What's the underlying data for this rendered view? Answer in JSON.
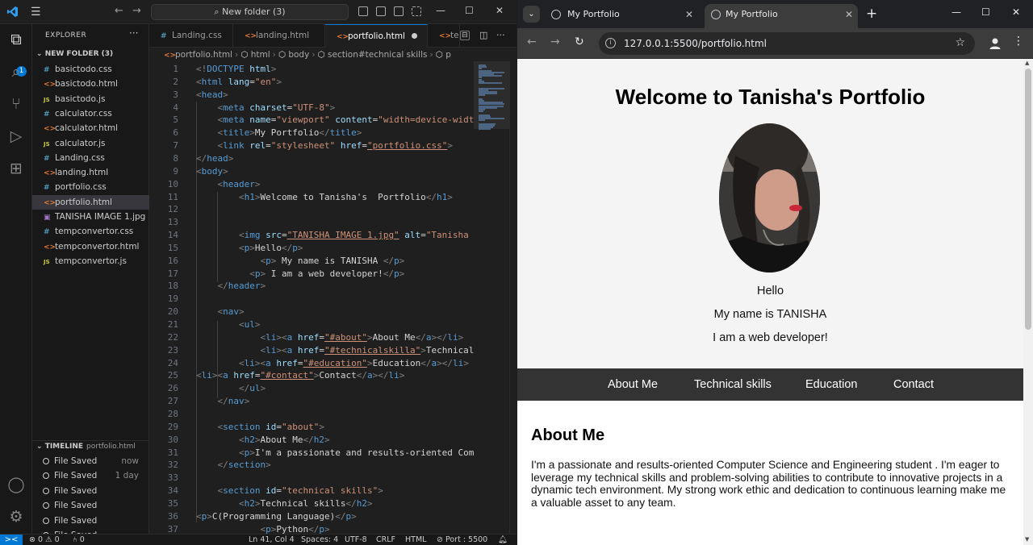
{
  "vscode": {
    "search": "New folder (3)",
    "explorer": {
      "header": "EXPLORER",
      "folder": "NEW FOLDER (3)",
      "files": [
        {
          "name": "basictodo.css",
          "type": "css"
        },
        {
          "name": "basictodo.html",
          "type": "html"
        },
        {
          "name": "basictodo.js",
          "type": "js"
        },
        {
          "name": "calculator.css",
          "type": "css"
        },
        {
          "name": "calculator.html",
          "type": "html"
        },
        {
          "name": "calculator.js",
          "type": "js"
        },
        {
          "name": "Landing.css",
          "type": "css"
        },
        {
          "name": "landing.html",
          "type": "html"
        },
        {
          "name": "portfolio.css",
          "type": "css"
        },
        {
          "name": "portfolio.html",
          "type": "html",
          "active": true
        },
        {
          "name": "TANISHA IMAGE 1.jpg",
          "type": "img"
        },
        {
          "name": "tempconvertor.css",
          "type": "css"
        },
        {
          "name": "tempconvertor.html",
          "type": "html"
        },
        {
          "name": "tempconvertor.js",
          "type": "js"
        }
      ]
    },
    "timeline": {
      "header": "TIMELINE",
      "file": "portfolio.html",
      "entries": [
        {
          "label": "File Saved",
          "time": "now"
        },
        {
          "label": "File Saved",
          "time": "1 day"
        },
        {
          "label": "File Saved",
          "time": ""
        },
        {
          "label": "File Saved",
          "time": ""
        },
        {
          "label": "File Saved",
          "time": ""
        },
        {
          "label": "File Saved",
          "time": ""
        }
      ]
    },
    "tabs": [
      {
        "label": "Landing.css",
        "type": "css"
      },
      {
        "label": "landing.html",
        "type": "html"
      },
      {
        "label": "portfolio.html",
        "type": "html",
        "active": true,
        "dirty": true
      },
      {
        "label": "tem",
        "type": "html"
      }
    ],
    "breadcrumb": [
      "portfolio.html",
      "html",
      "body",
      "section#technical skills",
      "p"
    ],
    "code_lines": [
      [
        [
          "d",
          "<!"
        ],
        [
          "t",
          "DOCTYPE"
        ],
        [
          "a",
          " html"
        ],
        [
          "d",
          ">"
        ]
      ],
      [
        [
          "d",
          "<"
        ],
        [
          "t",
          "html"
        ],
        [
          "a",
          " lang"
        ],
        [
          "x",
          "="
        ],
        [
          "s",
          "\"en\""
        ],
        [
          "d",
          ">"
        ]
      ],
      [
        [
          "d",
          "<"
        ],
        [
          "t",
          "head"
        ],
        [
          "d",
          ">"
        ]
      ],
      [
        [
          "x",
          "    "
        ],
        [
          "d",
          "<"
        ],
        [
          "t",
          "meta"
        ],
        [
          "a",
          " charset"
        ],
        [
          "x",
          "="
        ],
        [
          "s",
          "\"UTF-8\""
        ],
        [
          "d",
          ">"
        ]
      ],
      [
        [
          "x",
          "    "
        ],
        [
          "d",
          "<"
        ],
        [
          "t",
          "meta"
        ],
        [
          "a",
          " name"
        ],
        [
          "x",
          "="
        ],
        [
          "s",
          "\"viewport\""
        ],
        [
          "a",
          " content"
        ],
        [
          "x",
          "="
        ],
        [
          "s",
          "\"width=device-width,"
        ]
      ],
      [
        [
          "x",
          "    "
        ],
        [
          "d",
          "<"
        ],
        [
          "t",
          "title"
        ],
        [
          "d",
          ">"
        ],
        [
          "x",
          "My Portfolio"
        ],
        [
          "d",
          "</"
        ],
        [
          "t",
          "title"
        ],
        [
          "d",
          ">"
        ]
      ],
      [
        [
          "x",
          "    "
        ],
        [
          "d",
          "<"
        ],
        [
          "t",
          "link"
        ],
        [
          "a",
          " rel"
        ],
        [
          "x",
          "="
        ],
        [
          "s",
          "\"stylesheet\""
        ],
        [
          "a",
          " href"
        ],
        [
          "x",
          "="
        ],
        [
          "u",
          "\"portfolio.css\""
        ],
        [
          "d",
          ">"
        ]
      ],
      [
        [
          "d",
          "</"
        ],
        [
          "t",
          "head"
        ],
        [
          "d",
          ">"
        ]
      ],
      [
        [
          "d",
          "<"
        ],
        [
          "t",
          "body"
        ],
        [
          "d",
          ">"
        ]
      ],
      [
        [
          "x",
          "    "
        ],
        [
          "d",
          "<"
        ],
        [
          "t",
          "header"
        ],
        [
          "d",
          ">"
        ]
      ],
      [
        [
          "x",
          "        "
        ],
        [
          "d",
          "<"
        ],
        [
          "t",
          "h1"
        ],
        [
          "d",
          ">"
        ],
        [
          "x",
          "Welcome to Tanisha's  Portfolio"
        ],
        [
          "d",
          "</"
        ],
        [
          "t",
          "h1"
        ],
        [
          "d",
          ">"
        ]
      ],
      [],
      [],
      [
        [
          "x",
          "        "
        ],
        [
          "d",
          "<"
        ],
        [
          "t",
          "img"
        ],
        [
          "a",
          " src"
        ],
        [
          "x",
          "="
        ],
        [
          "u",
          "\"TANISHA IMAGE 1.jpg\""
        ],
        [
          "a",
          " alt"
        ],
        [
          "x",
          "="
        ],
        [
          "s",
          "\"Tanisha T"
        ]
      ],
      [
        [
          "x",
          "        "
        ],
        [
          "d",
          "<"
        ],
        [
          "t",
          "p"
        ],
        [
          "d",
          ">"
        ],
        [
          "x",
          "Hello"
        ],
        [
          "d",
          "</"
        ],
        [
          "t",
          "p"
        ],
        [
          "d",
          ">"
        ]
      ],
      [
        [
          "x",
          "            "
        ],
        [
          "d",
          "<"
        ],
        [
          "t",
          "p"
        ],
        [
          "d",
          ">"
        ],
        [
          "x",
          " My name is TANISHA "
        ],
        [
          "d",
          "</"
        ],
        [
          "t",
          "p"
        ],
        [
          "d",
          ">"
        ]
      ],
      [
        [
          "x",
          "          "
        ],
        [
          "d",
          "<"
        ],
        [
          "t",
          "p"
        ],
        [
          "d",
          ">"
        ],
        [
          "x",
          " I am a web developer!"
        ],
        [
          "d",
          "</"
        ],
        [
          "t",
          "p"
        ],
        [
          "d",
          ">"
        ]
      ],
      [
        [
          "x",
          "    "
        ],
        [
          "d",
          "</"
        ],
        [
          "t",
          "header"
        ],
        [
          "d",
          ">"
        ]
      ],
      [],
      [
        [
          "x",
          "    "
        ],
        [
          "d",
          "<"
        ],
        [
          "t",
          "nav"
        ],
        [
          "d",
          ">"
        ]
      ],
      [
        [
          "x",
          "        "
        ],
        [
          "d",
          "<"
        ],
        [
          "t",
          "ul"
        ],
        [
          "d",
          ">"
        ]
      ],
      [
        [
          "x",
          "            "
        ],
        [
          "d",
          "<"
        ],
        [
          "t",
          "li"
        ],
        [
          "d",
          "><"
        ],
        [
          "t",
          "a"
        ],
        [
          "a",
          " href"
        ],
        [
          "x",
          "="
        ],
        [
          "u",
          "\"#about\""
        ],
        [
          "d",
          ">"
        ],
        [
          "x",
          "About Me"
        ],
        [
          "d",
          "</"
        ],
        [
          "t",
          "a"
        ],
        [
          "d",
          "></"
        ],
        [
          "t",
          "li"
        ],
        [
          "d",
          ">"
        ]
      ],
      [
        [
          "x",
          "            "
        ],
        [
          "d",
          "<"
        ],
        [
          "t",
          "li"
        ],
        [
          "d",
          "><"
        ],
        [
          "t",
          "a"
        ],
        [
          "a",
          " href"
        ],
        [
          "x",
          "="
        ],
        [
          "u",
          "\"#technicalskilla\""
        ],
        [
          "d",
          ">"
        ],
        [
          "x",
          "Technical s"
        ]
      ],
      [
        [
          "x",
          "        "
        ],
        [
          "d",
          "<"
        ],
        [
          "t",
          "li"
        ],
        [
          "d",
          "><"
        ],
        [
          "t",
          "a"
        ],
        [
          "a",
          " href"
        ],
        [
          "x",
          "="
        ],
        [
          "u",
          "\"#education\""
        ],
        [
          "d",
          ">"
        ],
        [
          "x",
          "Education"
        ],
        [
          "d",
          "</"
        ],
        [
          "t",
          "a"
        ],
        [
          "d",
          "></"
        ],
        [
          "t",
          "li"
        ],
        [
          "d",
          ">"
        ]
      ],
      [
        [
          "d",
          "<"
        ],
        [
          "t",
          "li"
        ],
        [
          "d",
          "><"
        ],
        [
          "t",
          "a"
        ],
        [
          "a",
          " href"
        ],
        [
          "x",
          "="
        ],
        [
          "u",
          "\"#contact\""
        ],
        [
          "d",
          ">"
        ],
        [
          "x",
          "Contact"
        ],
        [
          "d",
          "</"
        ],
        [
          "t",
          "a"
        ],
        [
          "d",
          "></"
        ],
        [
          "t",
          "li"
        ],
        [
          "d",
          ">"
        ]
      ],
      [
        [
          "x",
          "        "
        ],
        [
          "d",
          "</"
        ],
        [
          "t",
          "ul"
        ],
        [
          "d",
          ">"
        ]
      ],
      [
        [
          "x",
          "    "
        ],
        [
          "d",
          "</"
        ],
        [
          "t",
          "nav"
        ],
        [
          "d",
          ">"
        ]
      ],
      [],
      [
        [
          "x",
          "    "
        ],
        [
          "d",
          "<"
        ],
        [
          "t",
          "section"
        ],
        [
          "a",
          " id"
        ],
        [
          "x",
          "="
        ],
        [
          "s",
          "\"about\""
        ],
        [
          "d",
          ">"
        ]
      ],
      [
        [
          "x",
          "        "
        ],
        [
          "d",
          "<"
        ],
        [
          "t",
          "h2"
        ],
        [
          "d",
          ">"
        ],
        [
          "x",
          "About Me"
        ],
        [
          "d",
          "</"
        ],
        [
          "t",
          "h2"
        ],
        [
          "d",
          ">"
        ]
      ],
      [
        [
          "x",
          "        "
        ],
        [
          "d",
          "<"
        ],
        [
          "t",
          "p"
        ],
        [
          "d",
          ">"
        ],
        [
          "x",
          "I'm a passionate and results-oriented Compu"
        ]
      ],
      [
        [
          "x",
          "    "
        ],
        [
          "d",
          "</"
        ],
        [
          "t",
          "section"
        ],
        [
          "d",
          ">"
        ]
      ],
      [],
      [
        [
          "x",
          "    "
        ],
        [
          "d",
          "<"
        ],
        [
          "t",
          "section"
        ],
        [
          "a",
          " id"
        ],
        [
          "x",
          "="
        ],
        [
          "s",
          "\"technical skills\""
        ],
        [
          "d",
          ">"
        ]
      ],
      [
        [
          "x",
          "        "
        ],
        [
          "d",
          "<"
        ],
        [
          "t",
          "h2"
        ],
        [
          "d",
          ">"
        ],
        [
          "x",
          "Technical skills"
        ],
        [
          "d",
          "</"
        ],
        [
          "t",
          "h2"
        ],
        [
          "d",
          ">"
        ]
      ],
      [
        [
          "d",
          "<"
        ],
        [
          "t",
          "p"
        ],
        [
          "d",
          ">"
        ],
        [
          "x",
          "C(Programming Language)"
        ],
        [
          "d",
          "</"
        ],
        [
          "t",
          "p"
        ],
        [
          "d",
          ">"
        ]
      ],
      [
        [
          "x",
          "            "
        ],
        [
          "d",
          "<"
        ],
        [
          "t",
          "p"
        ],
        [
          "d",
          ">"
        ],
        [
          "x",
          "Python"
        ],
        [
          "d",
          "</"
        ],
        [
          "t",
          "p"
        ],
        [
          "d",
          ">"
        ]
      ]
    ],
    "status": {
      "remote": "><",
      "problems": "⊗ 0 ⚠ 0",
      "ports": "⑃ 0",
      "cursor": "Ln 41, Col 4",
      "spaces": "Spaces: 4",
      "encoding": "UTF-8",
      "eol": "CRLF",
      "language": "HTML",
      "port": "⊘ Port : 5500"
    }
  },
  "chrome": {
    "tabs": [
      {
        "title": "My Portfolio",
        "active": false
      },
      {
        "title": "My Portfolio",
        "active": true
      }
    ],
    "url": "127.0.0.1:5500/portfolio.html",
    "page": {
      "title": "Welcome to Tanisha's Portfolio",
      "hello": "Hello",
      "name_line": "My name is TANISHA",
      "role_line": "I am a web developer!",
      "nav": [
        "About Me",
        "Technical skills",
        "Education",
        "Contact"
      ],
      "about_heading": "About Me",
      "about_text": "I'm a passionate and results-oriented Computer Science and Engineering student . I'm eager to leverage my technical skills and problem-solving abilities to contribute to innovative projects in a dynamic tech environment. My strong work ethic and dedication to continuous learning make me a valuable asset to any team."
    }
  }
}
